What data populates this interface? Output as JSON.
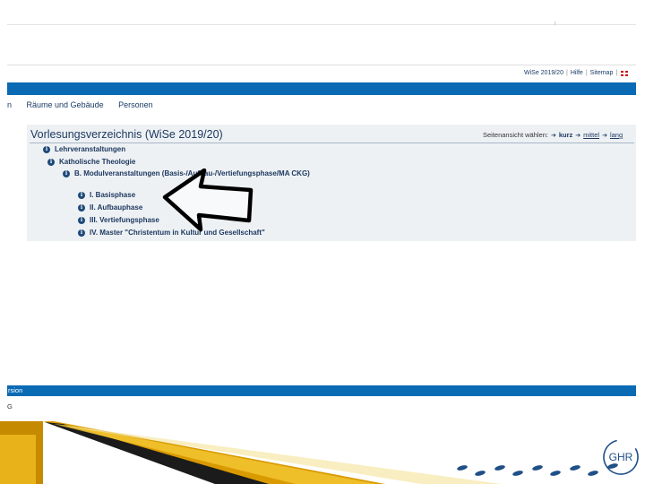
{
  "meta_links": {
    "semester": "WiSe 2019/20",
    "help": "Hilfe",
    "sitemap": "Sitemap"
  },
  "nav": {
    "partial": "n",
    "rooms": "Räume und Gebäude",
    "people": "Personen"
  },
  "panel": {
    "title": "Vorlesungsverzeichnis (WiSe 2019/20)",
    "view_select": {
      "label": "Seitenansicht wählen:",
      "options": [
        "kurz",
        "mittel",
        "lang"
      ],
      "selected": "kurz"
    },
    "tree": [
      {
        "label": "Lehrveranstaltungen",
        "level": 0
      },
      {
        "label": "Katholische Theologie",
        "level": 1
      },
      {
        "label": "B. Modulveranstaltungen (Basis-/Aufbau-/Vertiefungsphase/MA CKG)",
        "level": 2
      },
      {
        "label": "I. Basisphase",
        "level": 3
      },
      {
        "label": "II. Aufbauphase",
        "level": 3
      },
      {
        "label": "III. Vertiefungsphase",
        "level": 3
      },
      {
        "label": "IV. Master \"Christentum in Kultur und Gesellschaft\"",
        "level": 3
      }
    ]
  },
  "footer": {
    "band_text": "rsion",
    "letter": "G"
  },
  "logo": {
    "text": "GHR"
  },
  "colors": {
    "band_blue": "#0a6ab4",
    "title_navy": "#1d3960",
    "gold": "#e0a800",
    "logo_blue": "#1f4f86"
  }
}
